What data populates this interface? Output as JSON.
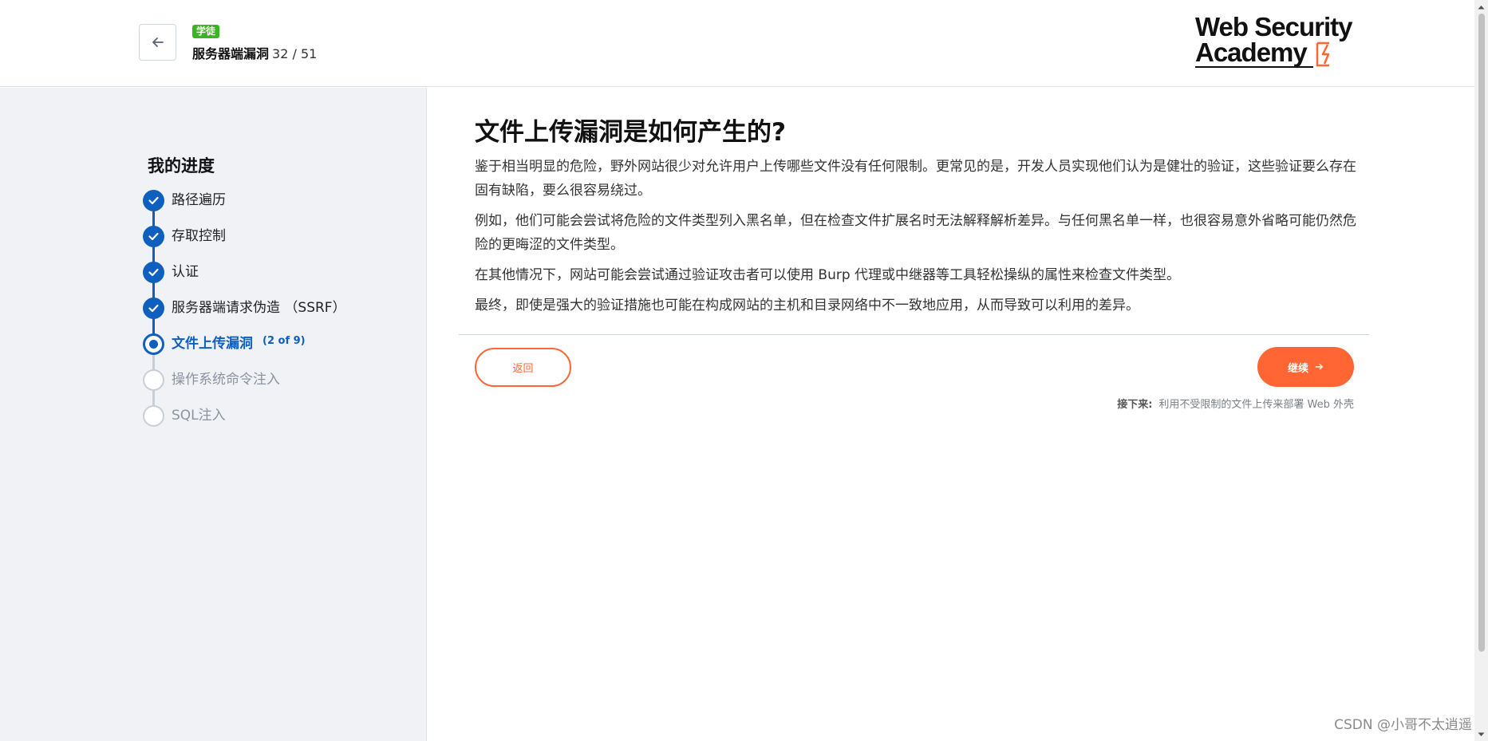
{
  "header": {
    "level_badge": "学徒",
    "topic_title": "服务器端漏洞",
    "topic_count": "32 / 51",
    "logo_line1": "Web Security",
    "logo_line2": "Academy"
  },
  "sidebar": {
    "title": "我的进度",
    "steps": [
      {
        "label": "路径遍历",
        "status": "done"
      },
      {
        "label": "存取控制",
        "status": "done"
      },
      {
        "label": "认证",
        "status": "done"
      },
      {
        "label": "服务器端请求伪造 （SSRF）",
        "status": "done"
      },
      {
        "label": "文件上传漏洞",
        "status": "current",
        "sub": "(2 of 9)"
      },
      {
        "label": "操作系统命令注入",
        "status": "pending"
      },
      {
        "label": "SQL注入",
        "status": "pending"
      }
    ]
  },
  "main": {
    "heading": "文件上传漏洞是如何产生的?",
    "paragraphs": [
      "鉴于相当明显的危险，野外网站很少对允许用户上传哪些文件没有任何限制。更常见的是，开发人员实现他们认为是健壮的验证，这些验证要么存在固有缺陷，要么很容易绕过。",
      "例如，他们可能会尝试将危险的文件类型列入黑名单，但在检查文件扩展名时无法解释解析差异。与任何黑名单一样，也很容易意外省略可能仍然危险的更晦涩的文件类型。",
      "在其他情况下，网站可能会尝试通过验证攻击者可以使用 Burp 代理或中继器等工具轻松操纵的属性来检查文件类型。",
      "最终，即使是强大的验证措施也可能在构成网站的主机和目录网络中不一致地应用，从而导致可以利用的差异。"
    ],
    "back_label": "返回",
    "continue_label": "继续",
    "next_prefix": "接下来:",
    "next_topic": "利用不受限制的文件上传来部署 Web 外壳"
  },
  "watermark": "CSDN @小哥不太逍遥",
  "colors": {
    "accent_orange": "#ff6633",
    "progress_blue": "#0f5fbf",
    "badge_green": "#3bb324"
  }
}
